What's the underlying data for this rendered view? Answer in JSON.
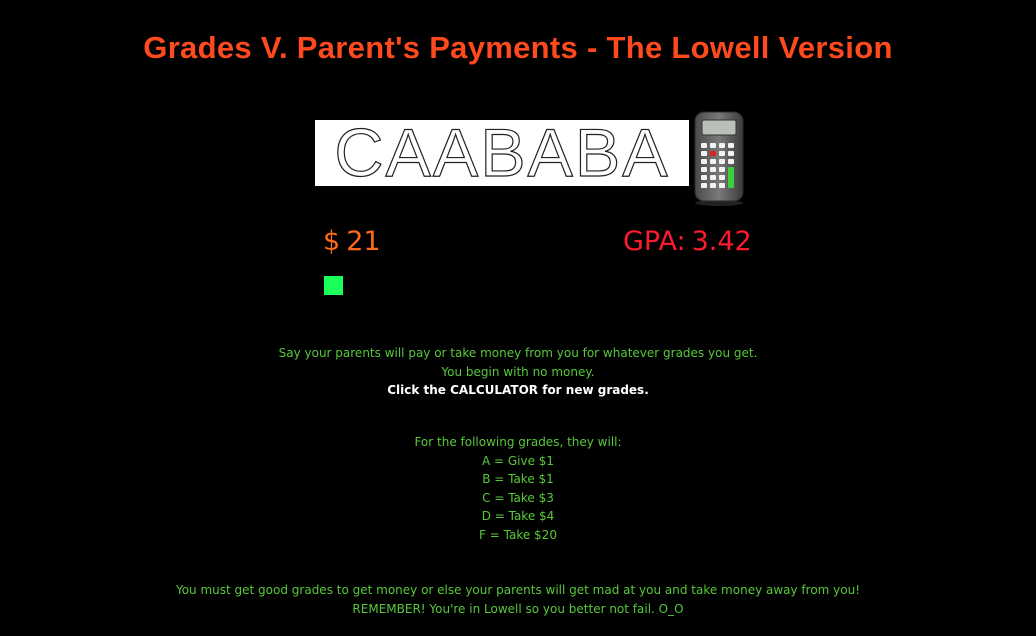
{
  "title": "Grades V. Parent's Payments - The Lowell Version",
  "grades_display": "CAABABA",
  "calculator": {
    "icon": "calculator-icon"
  },
  "stats": {
    "currency_symbol": "$",
    "money_value": "21",
    "gpa_label": "GPA:",
    "gpa_value": "3.42"
  },
  "indicator_color": "#1aff5a",
  "intro": {
    "line1": "Say your parents will pay or take money from you for whatever grades you get.",
    "line2": "You begin with no money.",
    "cta": "Click the CALCULATOR for new grades."
  },
  "rules": {
    "heading": "For the following grades, they will:",
    "items": [
      "A = Give $1",
      "B = Take $1",
      "C = Take $3",
      "D = Take $4",
      "F = Take $20"
    ]
  },
  "warning": {
    "line1": "You must get good grades to get money or else your parents will get mad at you and take money away from you!",
    "line2": "REMEMBER! You're in Lowell so you better not fail. O_O"
  },
  "colors": {
    "background": "#000000",
    "title": "#ff4a1e",
    "money": "#ff6a1a",
    "gpa": "#ff1a2e",
    "instructions": "#58c83a",
    "cta": "#ffffff"
  }
}
